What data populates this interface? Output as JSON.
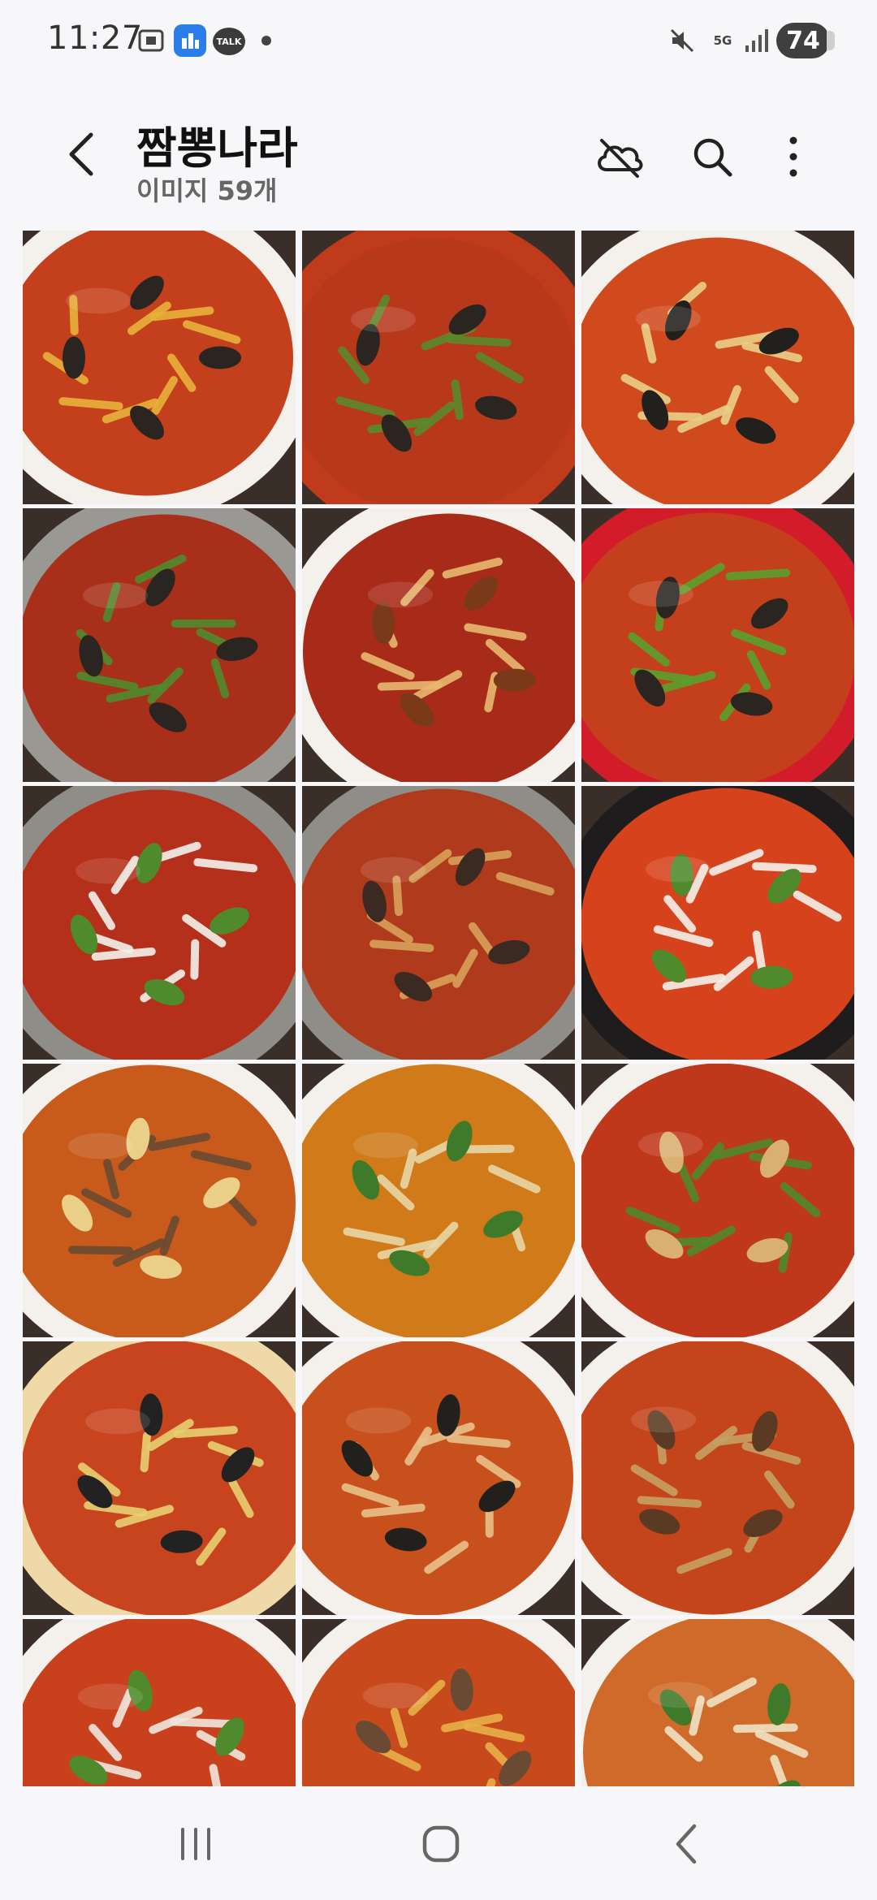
{
  "status_bar": {
    "time": "11:27",
    "talk_badge": "TALK",
    "network": "5G",
    "battery": "74"
  },
  "header": {
    "title": "짬뽕나라",
    "subtitle": "이미지 59개"
  },
  "photos": [
    {
      "bowl": "#f4f1ec",
      "soup": "#c4401c",
      "topping": "#e8b23a",
      "accent": "#2a2520"
    },
    {
      "bowl": "#c03a1c",
      "soup": "#b8381c",
      "topping": "#5a8a2a",
      "accent": "#2a2520"
    },
    {
      "bowl": "#f4f1ec",
      "soup": "#d04a1e",
      "topping": "#e9cf88",
      "accent": "#22201c"
    },
    {
      "bowl": "#9a9893",
      "soup": "#a8301a",
      "topping": "#4f8a2c",
      "accent": "#2a2520"
    },
    {
      "bowl": "#f4f1ec",
      "soup": "#a82a18",
      "topping": "#e8b870",
      "accent": "#7a3a1a"
    },
    {
      "bowl": "#d21c2a",
      "soup": "#c4401c",
      "topping": "#5aa02c",
      "accent": "#2a2520"
    },
    {
      "bowl": "#8f8d88",
      "soup": "#b4301a",
      "topping": "#f4f1ec",
      "accent": "#4f8a2c"
    },
    {
      "bowl": "#8f8d88",
      "soup": "#b03a1c",
      "topping": "#d9a15a",
      "accent": "#3a2a22"
    },
    {
      "bowl": "#1e1c1c",
      "soup": "#d6421c",
      "topping": "#f6f1ea",
      "accent": "#4f8a2c"
    },
    {
      "bowl": "#f4f1ec",
      "soup": "#c85a1c",
      "topping": "#6a4a32",
      "accent": "#e9cf88"
    },
    {
      "bowl": "#f4f1ec",
      "soup": "#d07a1a",
      "topping": "#e8d6a6",
      "accent": "#3f7a2a"
    },
    {
      "bowl": "#f4f1ec",
      "soup": "#c0381c",
      "topping": "#4f8a2c",
      "accent": "#d9b070"
    },
    {
      "bowl": "#f0d9a8",
      "soup": "#c8441e",
      "topping": "#e8d070",
      "accent": "#222"
    },
    {
      "bowl": "#f4f1ec",
      "soup": "#c8501c",
      "topping": "#e8c088",
      "accent": "#22201c"
    },
    {
      "bowl": "#f4f1ec",
      "soup": "#c4441c",
      "topping": "#c6a062",
      "accent": "#5a3a22"
    },
    {
      "bowl": "#f4f1ec",
      "soup": "#c8401c",
      "topping": "#f0e6dc",
      "accent": "#4f8a2c"
    },
    {
      "bowl": "#f4f1ec",
      "soup": "#c84a1c",
      "topping": "#e8b048",
      "accent": "#6a4a32"
    },
    {
      "bowl": "#f4f1ec",
      "soup": "#d06a2a",
      "topping": "#f1e2c4",
      "accent": "#3f7a2a"
    }
  ],
  "colors": {
    "background": "#f7f7f9",
    "text_primary": "#111111",
    "text_secondary": "#666666"
  },
  "icons": {
    "back": "chevron-left-icon",
    "cloud": "cloud-off-icon",
    "search": "search-icon",
    "more": "more-vertical-icon"
  }
}
